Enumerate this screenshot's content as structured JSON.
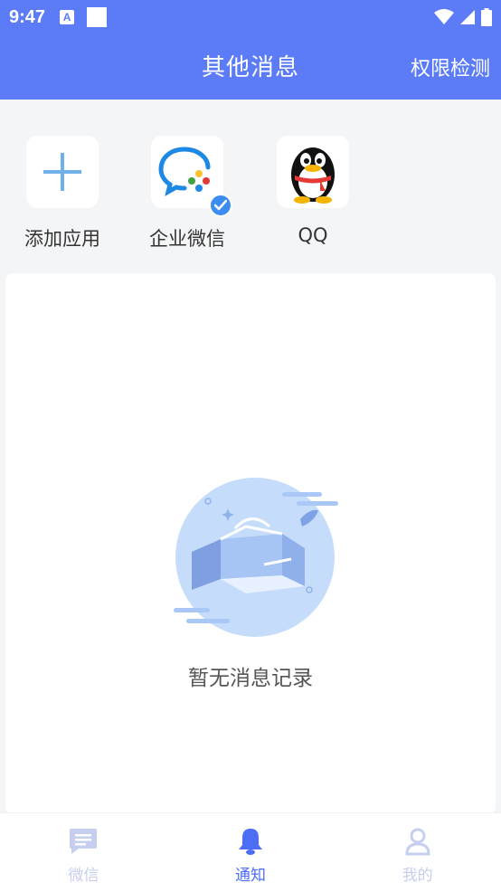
{
  "status_bar": {
    "time": "9:47",
    "notif_icon": "A"
  },
  "header": {
    "title": "其他消息",
    "action": "权限检测",
    "bg_color": "#5b7cf6"
  },
  "apps": [
    {
      "label": "添加应用",
      "icon": "plus-icon"
    },
    {
      "label": "企业微信",
      "icon": "wecom-icon",
      "selected": true
    },
    {
      "label": "QQ",
      "icon": "qq-penguin-icon"
    }
  ],
  "empty_state": {
    "text": "暂无消息记录",
    "icon": "empty-box-illustration"
  },
  "tabs": [
    {
      "label": "微信",
      "icon": "chat-icon",
      "active": false
    },
    {
      "label": "通知",
      "icon": "bell-icon",
      "active": true
    },
    {
      "label": "我的",
      "icon": "user-icon",
      "active": false
    }
  ],
  "colors": {
    "accent": "#4c6ef5",
    "inactive_tab": "#c6cfef"
  }
}
